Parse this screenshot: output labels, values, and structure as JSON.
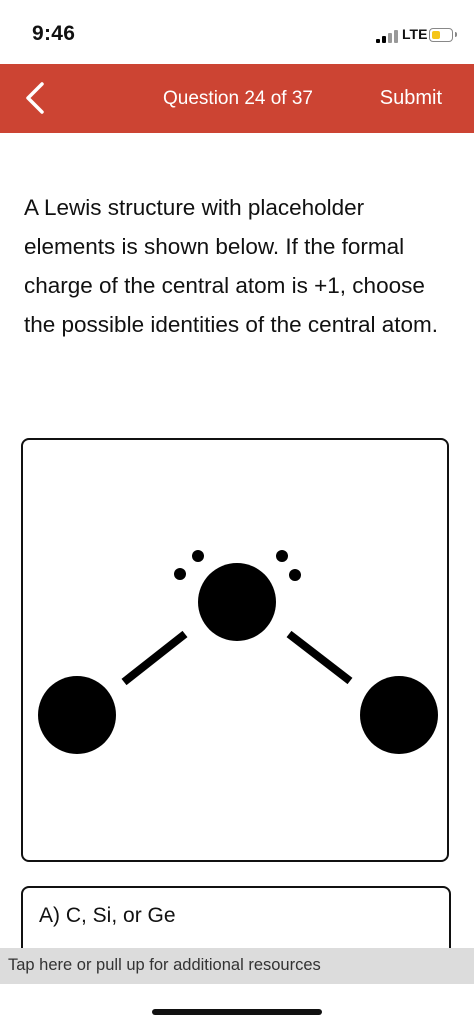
{
  "status_bar": {
    "time": "9:46",
    "network": "LTE",
    "battery_color": "#f5c518"
  },
  "header": {
    "title": "Question 24 of 37",
    "submit_label": "Submit",
    "background": "#cc4433",
    "back_icon": "chevron-left-icon"
  },
  "question": {
    "text": "A Lewis structure with placeholder elements is shown below. If the formal charge of the central atom is +1, choose the possible identities of the central atom."
  },
  "diagram": {
    "central_lone_pairs": 2,
    "bonds": 2,
    "outer_atoms": 2
  },
  "answer": {
    "label": "A) C, Si, or Ge"
  },
  "resources": {
    "text": "Tap here or pull up for additional resources"
  }
}
